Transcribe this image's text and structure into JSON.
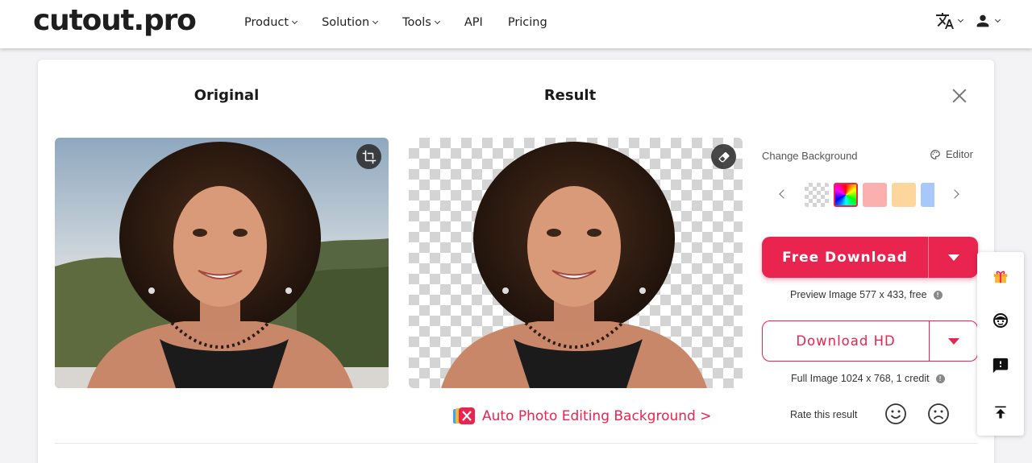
{
  "header": {
    "logo": "cutout.pro",
    "nav": [
      {
        "label": "Product",
        "has_menu": true
      },
      {
        "label": "Solution",
        "has_menu": true
      },
      {
        "label": "Tools",
        "has_menu": true
      },
      {
        "label": "API",
        "has_menu": false
      },
      {
        "label": "Pricing",
        "has_menu": false
      }
    ],
    "icons": [
      "translate-icon",
      "user-icon"
    ]
  },
  "card": {
    "original_title": "Original",
    "result_title": "Result",
    "promo_text": "Auto Photo Editing Background >"
  },
  "panel": {
    "change_background_label": "Change Background",
    "editor_label": "Editor",
    "swatches": [
      "transparent",
      "rainbow",
      "#fbb0b0",
      "#fdd69e",
      "#a8c8fb"
    ],
    "free_download_label": "Free Download",
    "preview_info": "Preview Image 577 x 433, free",
    "download_hd_label": "Download HD",
    "full_info": "Full Image 1024 x 768, 1 credit",
    "rate_label": "Rate this result"
  },
  "sidebar": [
    "gift-icon",
    "support-agent-icon",
    "feedback-icon",
    "back-to-top-icon"
  ],
  "colors": {
    "accent": "#e8244f",
    "text": "#222222"
  }
}
